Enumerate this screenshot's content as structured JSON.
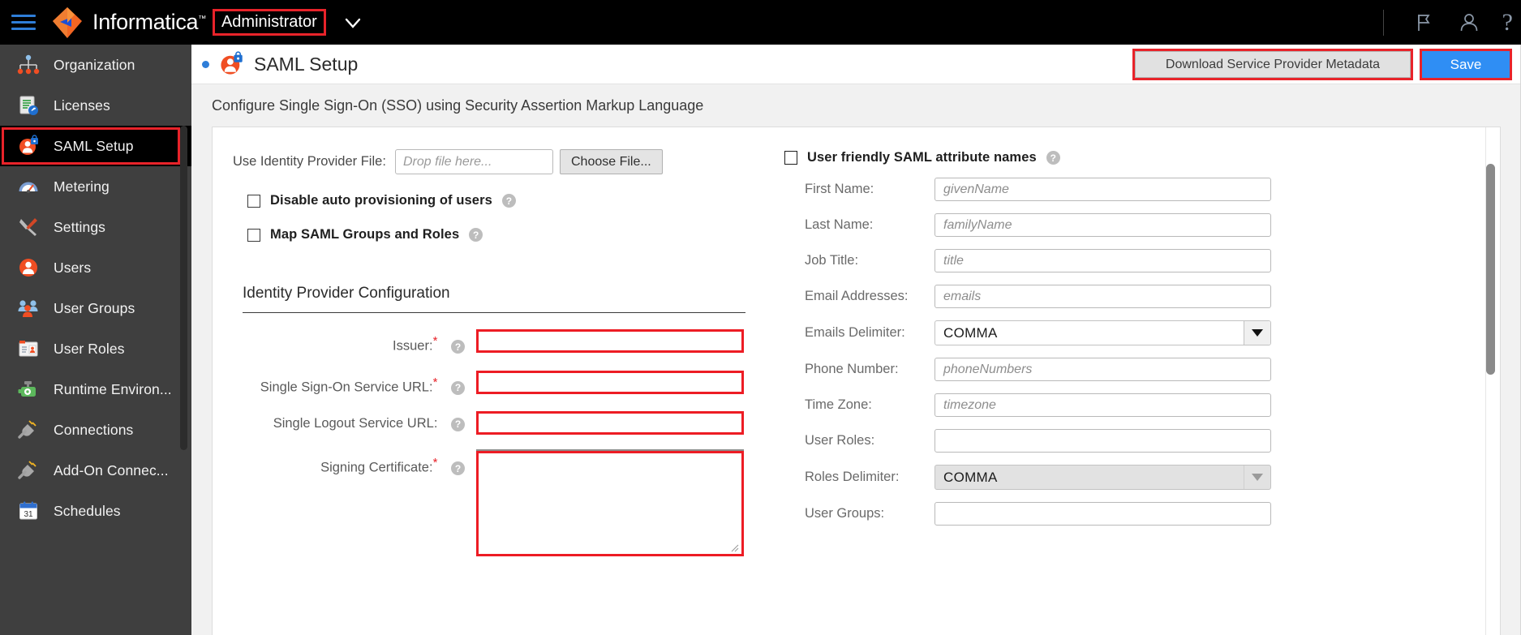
{
  "topbar": {
    "menu_icon": "hamburger-icon",
    "brand": "Informatica",
    "brand_tm": "™",
    "role_chip": "Administrator",
    "chevron_icon": "chevron-down-icon",
    "flag_icon": "flag-icon",
    "user_icon": "user-icon",
    "help_label": "?"
  },
  "sidebar": {
    "items": [
      {
        "label": "Organization",
        "icon": "org-chart-icon",
        "active": false
      },
      {
        "label": "Licenses",
        "icon": "license-key-icon",
        "active": false
      },
      {
        "label": "SAML Setup",
        "icon": "user-lock-icon",
        "active": true
      },
      {
        "label": "Metering",
        "icon": "gauge-icon",
        "active": false
      },
      {
        "label": "Settings",
        "icon": "wrench-screwdriver-icon",
        "active": false
      },
      {
        "label": "Users",
        "icon": "user-circle-icon",
        "active": false
      },
      {
        "label": "User Groups",
        "icon": "users-group-icon",
        "active": false
      },
      {
        "label": "User Roles",
        "icon": "id-badge-icon",
        "active": false
      },
      {
        "label": "Runtime Environ...",
        "icon": "runtime-engine-icon",
        "active": false
      },
      {
        "label": "Connections",
        "icon": "plug-icon",
        "active": false
      },
      {
        "label": "Add-On Connec...",
        "icon": "plug-addon-icon",
        "active": false
      },
      {
        "label": "Schedules",
        "icon": "calendar-31-icon",
        "active": false
      }
    ]
  },
  "page": {
    "status_dot": "blue-status-dot",
    "icon": "user-lock-icon",
    "title": "SAML Setup",
    "download_button": "Download Service Provider Metadata",
    "save_button": "Save",
    "subtitle": "Configure Single Sign-On (SSO) using Security Assertion Markup Language"
  },
  "left_form": {
    "idp_file_label": "Use Identity Provider File:",
    "idp_file_placeholder": "Drop file here...",
    "choose_file_button": "Choose File...",
    "checkboxes": [
      {
        "label": "Disable auto provisioning of users",
        "checked": false,
        "help": "?"
      },
      {
        "label": "Map SAML Groups and Roles",
        "checked": false,
        "help": "?"
      }
    ],
    "section_title": "Identity Provider Configuration",
    "fields": [
      {
        "label": "Issuer:",
        "required": true,
        "value": "",
        "type": "text",
        "help": "?"
      },
      {
        "label": "Single Sign-On Service URL:",
        "required": true,
        "value": "",
        "type": "text",
        "help": "?"
      },
      {
        "label": "Single Logout Service URL:",
        "required": false,
        "value": "",
        "type": "text",
        "help": "?"
      },
      {
        "label": "Signing Certificate:",
        "required": true,
        "value": "",
        "type": "textarea",
        "help": "?"
      }
    ]
  },
  "right_form": {
    "friendly_names_label": "User friendly SAML attribute names",
    "friendly_names_checked": false,
    "friendly_names_help": "?",
    "fields": [
      {
        "label": "First Name:",
        "value": "givenName",
        "type": "input",
        "disabled": false
      },
      {
        "label": "Last Name:",
        "value": "familyName",
        "type": "input",
        "disabled": false
      },
      {
        "label": "Job Title:",
        "value": "title",
        "type": "input",
        "disabled": false
      },
      {
        "label": "Email Addresses:",
        "value": "emails",
        "type": "input",
        "disabled": false
      },
      {
        "label": "Emails Delimiter:",
        "value": "COMMA",
        "type": "select",
        "disabled": false
      },
      {
        "label": "Phone Number:",
        "value": "phoneNumbers",
        "type": "input",
        "disabled": false
      },
      {
        "label": "Time Zone:",
        "value": "timezone",
        "type": "input",
        "disabled": false
      },
      {
        "label": "User Roles:",
        "value": "",
        "type": "input",
        "disabled": false
      },
      {
        "label": "Roles Delimiter:",
        "value": "COMMA",
        "type": "select",
        "disabled": true
      },
      {
        "label": "User Groups:",
        "value": "",
        "type": "input",
        "disabled": false
      }
    ]
  },
  "colors": {
    "brand_orange": "#f26522",
    "accent_blue": "#2f8ef4",
    "highlight_red": "#ed1c24",
    "sidebar_bg": "#3f3f3f",
    "topbar_bg": "#000000"
  }
}
